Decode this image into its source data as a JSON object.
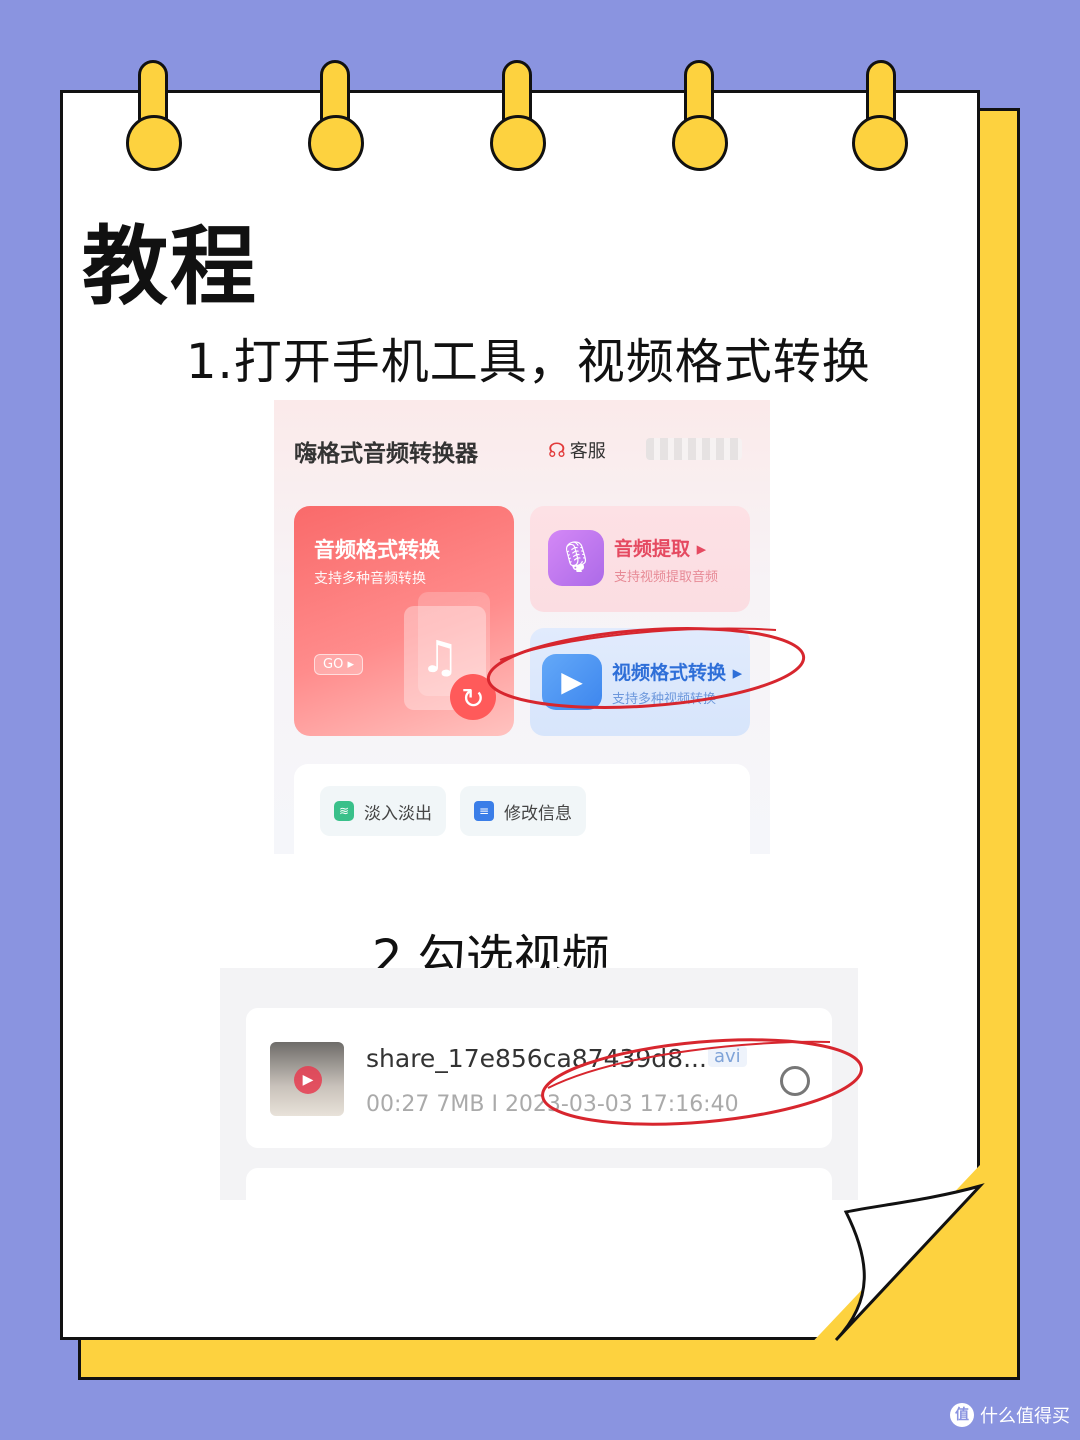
{
  "title": "教程",
  "step1": "1.打开手机工具，视频格式转换",
  "step2": "2.勾选视频",
  "app": {
    "name": "嗨格式音频转换器",
    "service": "客服",
    "main_card": {
      "title": "音频格式转换",
      "subtitle": "支持多种音频转换",
      "go": "GO"
    },
    "audio_card": {
      "title": "音频提取",
      "subtitle": "支持视频提取音频"
    },
    "video_card": {
      "title": "视频格式转换",
      "subtitle": "支持多种视频转换"
    },
    "tools": [
      {
        "label": "淡入淡出"
      },
      {
        "label": "修改信息"
      }
    ]
  },
  "file": {
    "name": "share_17e856ca87439d8...",
    "format": "avi",
    "meta": "00:27 7MB I 2023-03-03 17:16:40"
  },
  "watermark": "什么值得买",
  "colors": {
    "background": "#8a94e0",
    "notebook_edge": "#fdd23f",
    "annotation": "#d7262e"
  }
}
